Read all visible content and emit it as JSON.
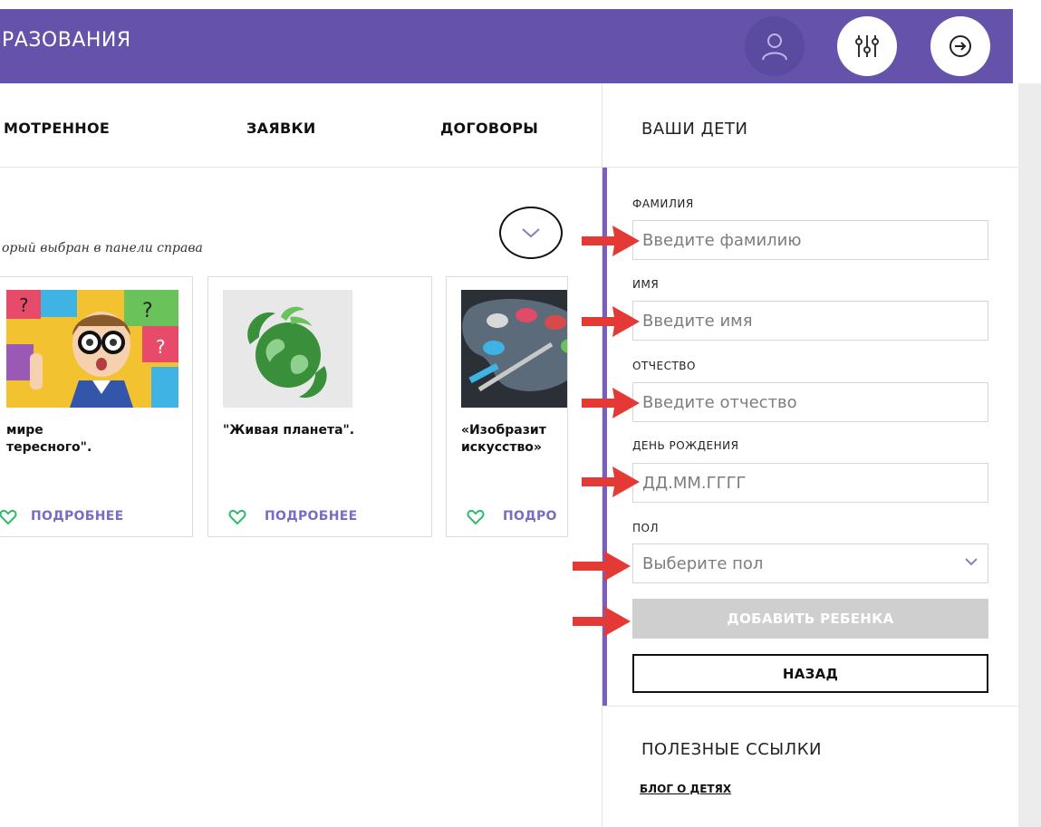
{
  "header": {
    "brand": "РАЗОВАНИЯ",
    "accent_color": "#6552aa",
    "icons": [
      "user-icon",
      "sliders-icon",
      "logout-icon"
    ]
  },
  "tabs": [
    {
      "label": "МОТРЕННОЕ"
    },
    {
      "label": "ЗАЯВКИ"
    },
    {
      "label": "ДОГОВОРЫ"
    }
  ],
  "main": {
    "hint": "орый выбран в панели справа",
    "cards": [
      {
        "title_lines": [
          "мире",
          "тересного\"."
        ],
        "more_label": "ПОДРОБНЕЕ"
      },
      {
        "title_lines": [
          "\"Живая планета\"."
        ],
        "more_label": "ПОДРОБНЕЕ"
      },
      {
        "title_lines": [
          "«Изобразит",
          "искусство»"
        ],
        "more_label": "ПОДРО"
      }
    ]
  },
  "panel": {
    "title": "ВАШИ ДЕТИ",
    "fields": [
      {
        "label": "ФАМИЛИЯ",
        "placeholder": "Введите фамилию"
      },
      {
        "label": "ИМЯ",
        "placeholder": "Введите имя"
      },
      {
        "label": "ОТЧЕСТВО",
        "placeholder": "Введите отчество"
      },
      {
        "label": "ДЕНЬ РОЖДЕНИЯ",
        "placeholder": "ДД.ММ.ГГГГ"
      }
    ],
    "gender": {
      "label": "ПОЛ",
      "placeholder": "Выберите пол"
    },
    "add_button": "ДОБАВИТЬ РЕБЕНКА",
    "back_button": "НАЗАД",
    "links_title": "ПОЛЕЗНЫЕ ССЫЛКИ",
    "links": [
      "БЛОГ О ДЕТЯХ"
    ]
  },
  "colors": {
    "arrow": "#e53935",
    "panel_accent": "#7b5fbd",
    "more_link": "#7a6cc0",
    "button_disabled": "#cfcfcf"
  }
}
